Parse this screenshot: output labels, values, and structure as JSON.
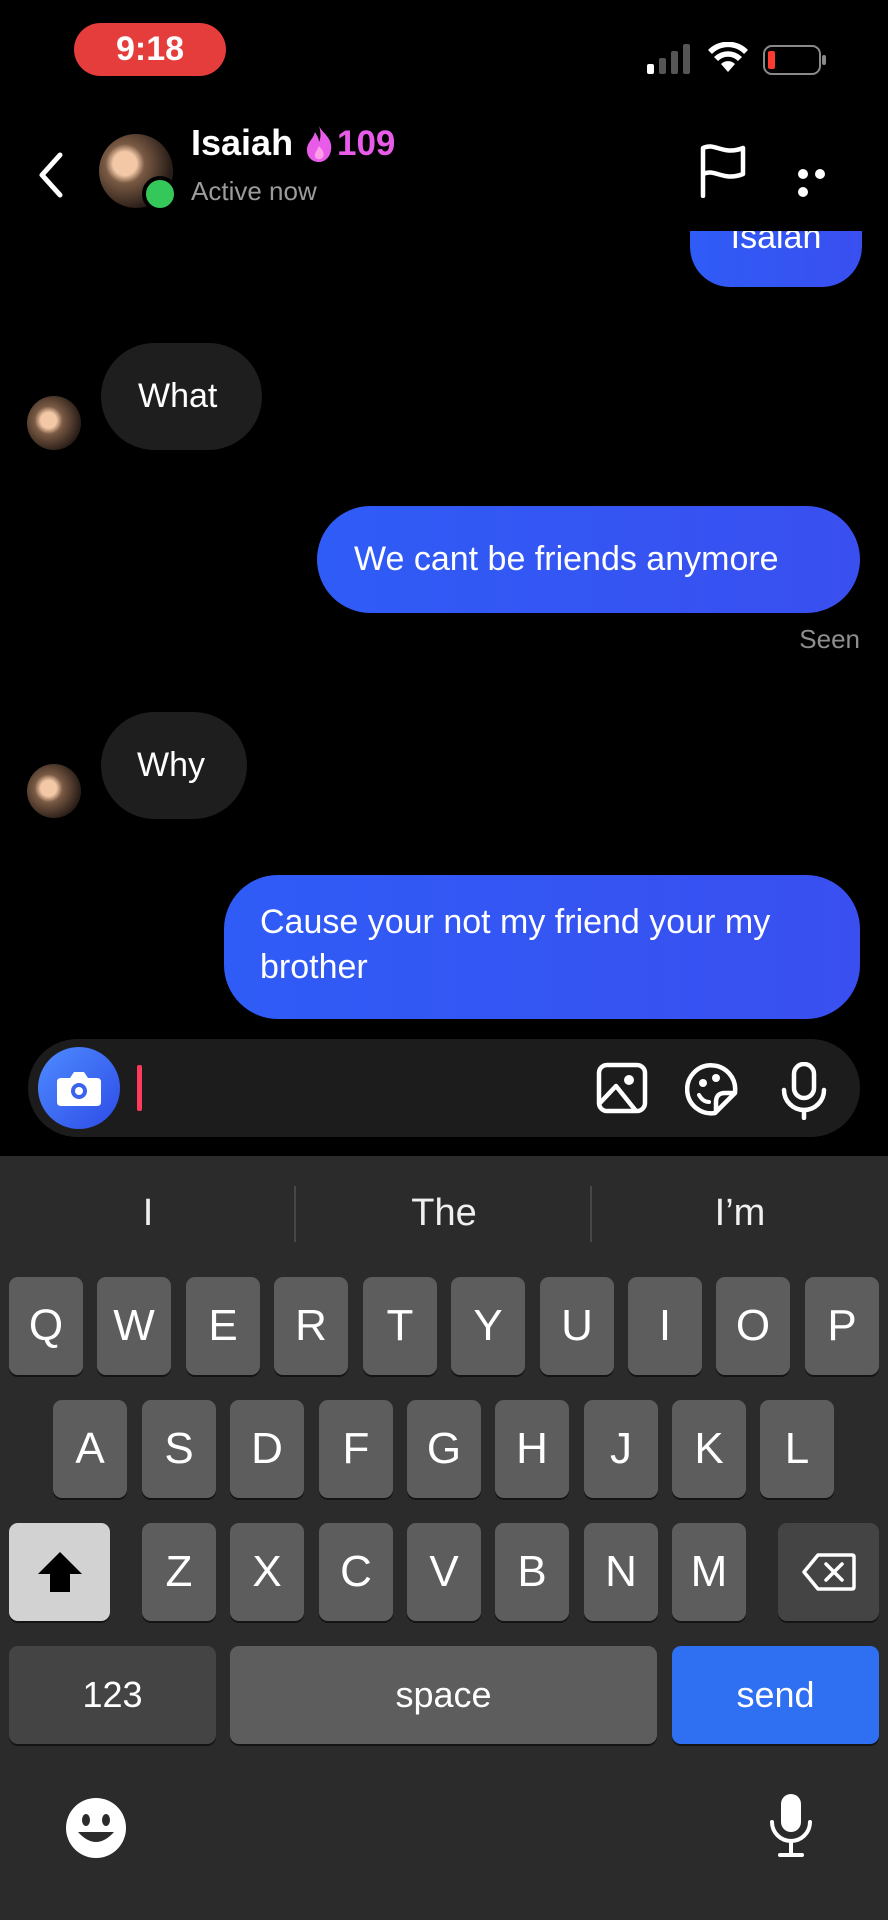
{
  "status_bar": {
    "time": "9:18"
  },
  "header": {
    "contact_name": "Isaiah",
    "streak_count": "109",
    "status": "Active now",
    "icons": [
      "back-icon",
      "flag-icon",
      "more-icon",
      "flame-icon"
    ]
  },
  "messages": {
    "clipped_outgoing": "Isaiah",
    "incoming_1": "What",
    "outgoing_1": "We cant be friends anymore",
    "seen_label": "Seen",
    "incoming_2": "Why",
    "outgoing_2": "Cause your not my friend your my brother"
  },
  "composer": {
    "input_value": "",
    "icons": [
      "camera-icon",
      "gallery-icon",
      "sticker-icon",
      "microphone-icon"
    ]
  },
  "keyboard": {
    "suggestions": [
      "I",
      "The",
      "I’m"
    ],
    "row1": [
      "Q",
      "W",
      "E",
      "R",
      "T",
      "Y",
      "U",
      "I",
      "O",
      "P"
    ],
    "row2": [
      "A",
      "S",
      "D",
      "F",
      "G",
      "H",
      "J",
      "K",
      "L"
    ],
    "row3": [
      "Z",
      "X",
      "C",
      "V",
      "B",
      "N",
      "M"
    ],
    "numbers_label": "123",
    "space_label": "space",
    "send_label": "send"
  },
  "colors": {
    "accent": "#2f5cf6",
    "time_pill": "#e53c3c",
    "streak": "#e95ce9",
    "online": "#34c759"
  }
}
